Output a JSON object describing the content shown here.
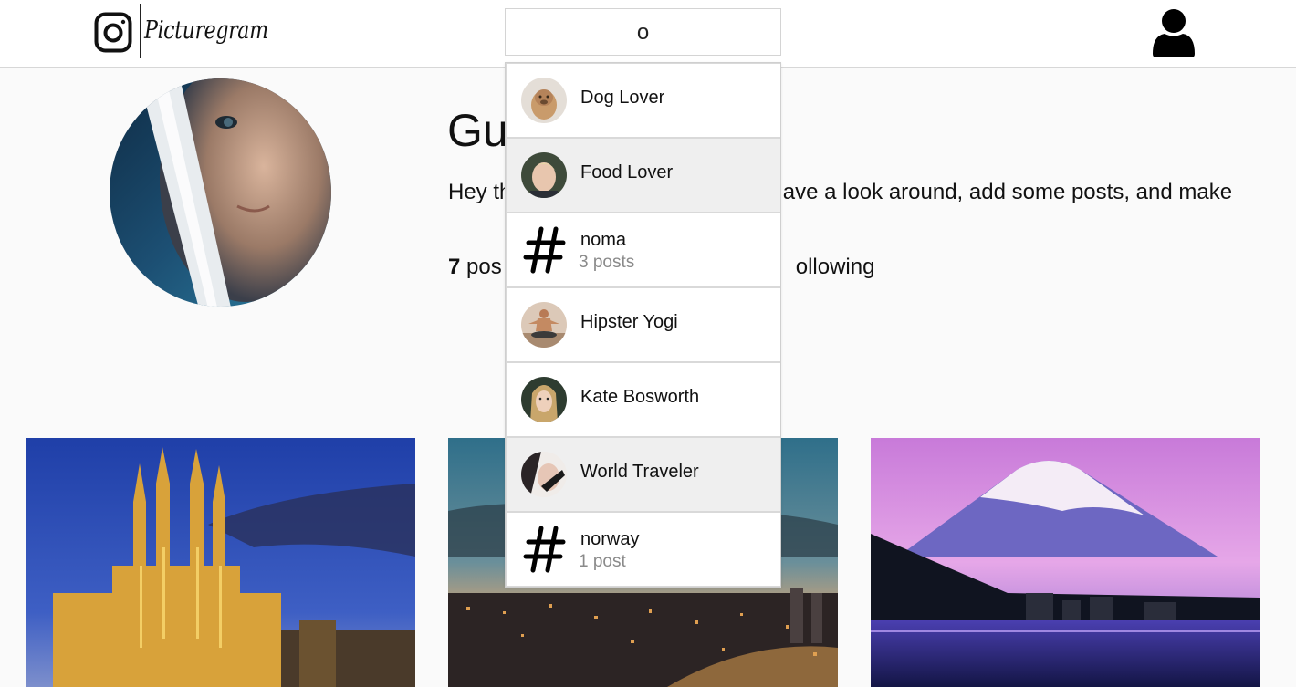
{
  "app": {
    "brand": "Picturegram"
  },
  "search": {
    "value": "o"
  },
  "profile": {
    "name": "Gu",
    "bio": "Hey th                                   am. Have a look around, add some posts, and make",
    "stats": {
      "posts_count": "7",
      "posts_label": " pos",
      "following_label": "ollowing"
    }
  },
  "results": [
    {
      "type": "user",
      "label": "Dog Lover",
      "avatar": "dog-photo"
    },
    {
      "type": "user",
      "label": "Food Lover",
      "avatar": "man-portrait",
      "highlighted": true
    },
    {
      "type": "hashtag",
      "label": "noma",
      "count": "3 posts"
    },
    {
      "type": "user",
      "label": "Hipster Yogi",
      "avatar": "yogi-photo"
    },
    {
      "type": "user",
      "label": "Kate Bosworth",
      "avatar": "woman-portrait"
    },
    {
      "type": "user",
      "label": "World Traveler",
      "avatar": "traveler-photo",
      "highlighted": true
    },
    {
      "type": "hashtag",
      "label": "norway",
      "count": "1 post"
    }
  ],
  "photos": [
    {
      "subject": "cathedral-night"
    },
    {
      "subject": "coastal-city-dusk"
    },
    {
      "subject": "snow-mountain-lake"
    }
  ],
  "colors": {
    "header_bg": "#ffffff",
    "page_bg": "#fafafa",
    "border": "#d7d7d7",
    "highlight": "#efefef",
    "muted": "#8a8a8a"
  }
}
